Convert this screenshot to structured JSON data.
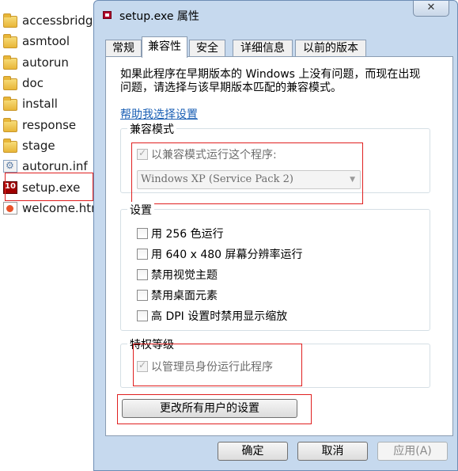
{
  "explorer": {
    "files": [
      {
        "name": "accessbridg",
        "icon": "folder-icon"
      },
      {
        "name": "asmtool",
        "icon": "folder-icon"
      },
      {
        "name": "autorun",
        "icon": "folder-icon"
      },
      {
        "name": "doc",
        "icon": "folder-icon"
      },
      {
        "name": "install",
        "icon": "folder-icon"
      },
      {
        "name": "response",
        "icon": "folder-icon"
      },
      {
        "name": "stage",
        "icon": "folder-icon"
      },
      {
        "name": "autorun.inf",
        "icon": "inf-file-icon"
      },
      {
        "name": "setup.exe",
        "icon": "exe-file-icon"
      },
      {
        "name": "welcome.htm",
        "icon": "html-file-icon"
      }
    ]
  },
  "dialog": {
    "title": "setup.exe 属性",
    "close_glyph": "✕",
    "tabs": [
      "常规",
      "兼容性",
      "安全",
      "详细信息",
      "以前的版本"
    ],
    "active_tab": "兼容性",
    "intro": "如果此程序在早期版本的 Windows 上没有问题，而现在出现问题，请选择与该早期版本匹配的兼容模式。",
    "help_link": "帮助我选择设置",
    "compat_mode": {
      "title": "兼容模式",
      "checkbox_label": "以兼容模式运行这个程序:",
      "checked": true,
      "select_value": "Windows XP (Service Pack 2)",
      "arrow_glyph": "▼"
    },
    "settings": {
      "title": "设置",
      "options": [
        "用 256 色运行",
        "用 640 x 480 屏幕分辨率运行",
        "禁用视觉主题",
        "禁用桌面元素",
        "高 DPI 设置时禁用显示缩放"
      ]
    },
    "privilege": {
      "title": "特权等级",
      "checkbox_label": "以管理员身份运行此程序",
      "checked": true
    },
    "change_all_users_button": "更改所有用户的设置",
    "ok_button": "确定",
    "cancel_button": "取消",
    "apply_button": "应用(A)"
  },
  "colors": {
    "window_frame": "#c6d9ee",
    "highlight_box": "#e02020",
    "link": "#1a5fb4"
  }
}
